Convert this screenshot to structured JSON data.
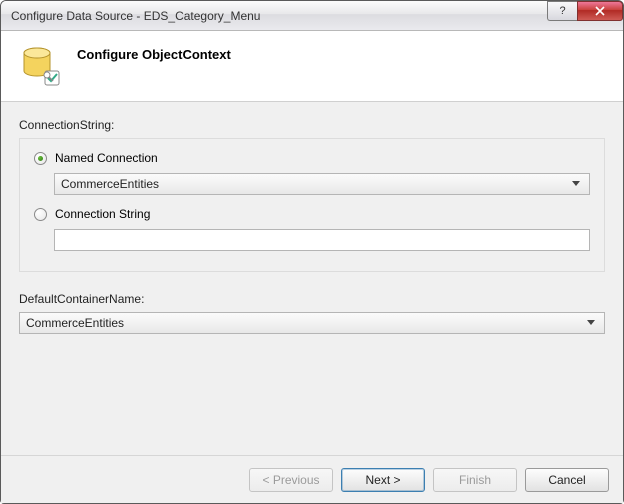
{
  "window": {
    "title": "Configure Data Source - EDS_Category_Menu",
    "help_symbol": "?"
  },
  "header": {
    "title": "Configure ObjectContext",
    "icon_name": "database-wizard-icon"
  },
  "connection": {
    "label": "ConnectionString:",
    "named": {
      "label": "Named Connection",
      "selected": true,
      "combo_value": "CommerceEntities"
    },
    "custom": {
      "label": "Connection String",
      "selected": false,
      "text_value": ""
    }
  },
  "container": {
    "label": "DefaultContainerName:",
    "combo_value": "CommerceEntities"
  },
  "footer": {
    "previous": "< Previous",
    "next": "Next >",
    "finish": "Finish",
    "cancel": "Cancel"
  }
}
